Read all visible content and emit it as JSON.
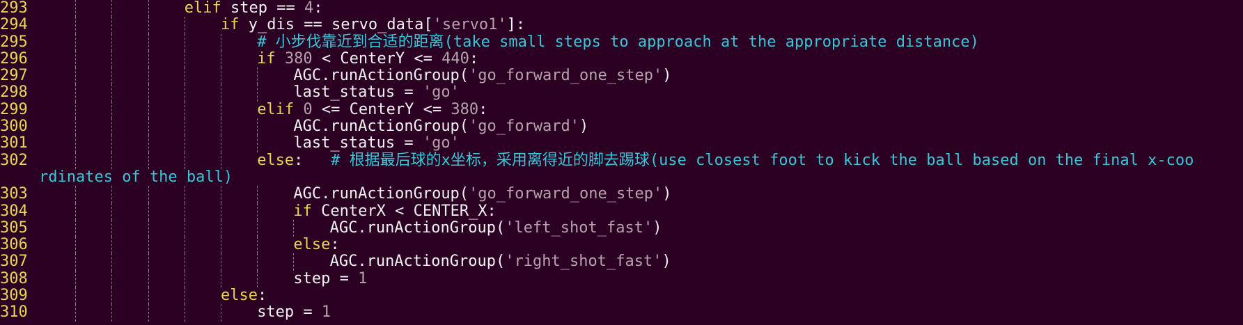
{
  "editor": {
    "lines": [
      {
        "num": "293",
        "indent": 4,
        "tokens": [
          {
            "t": "kw",
            "v": "elif"
          },
          {
            "t": "tx",
            "v": " step == "
          },
          {
            "t": "num",
            "v": "4"
          },
          {
            "t": "tx",
            "v": ":"
          }
        ]
      },
      {
        "num": "294",
        "indent": 5,
        "tokens": [
          {
            "t": "kw",
            "v": "if"
          },
          {
            "t": "tx",
            "v": " y_dis == servo_data["
          },
          {
            "t": "str",
            "v": "'servo1'"
          },
          {
            "t": "tx",
            "v": "]:"
          }
        ]
      },
      {
        "num": "295",
        "indent": 6,
        "tokens": [
          {
            "t": "cm",
            "v": "# 小步伐靠近到合适的距离(take small steps to approach at the appropriate distance)"
          }
        ]
      },
      {
        "num": "296",
        "indent": 6,
        "tokens": [
          {
            "t": "kw",
            "v": "if"
          },
          {
            "t": "tx",
            "v": " "
          },
          {
            "t": "num",
            "v": "380"
          },
          {
            "t": "tx",
            "v": " < CenterY <= "
          },
          {
            "t": "num",
            "v": "440"
          },
          {
            "t": "tx",
            "v": ":"
          }
        ]
      },
      {
        "num": "297",
        "indent": 7,
        "tokens": [
          {
            "t": "tx",
            "v": "AGC.runActionGroup("
          },
          {
            "t": "str",
            "v": "'go_forward_one_step'"
          },
          {
            "t": "tx",
            "v": ")"
          }
        ]
      },
      {
        "num": "298",
        "indent": 7,
        "tokens": [
          {
            "t": "tx",
            "v": "last_status = "
          },
          {
            "t": "str",
            "v": "'go'"
          }
        ]
      },
      {
        "num": "299",
        "indent": 6,
        "tokens": [
          {
            "t": "kw",
            "v": "elif"
          },
          {
            "t": "tx",
            "v": " "
          },
          {
            "t": "num",
            "v": "0"
          },
          {
            "t": "tx",
            "v": " <= CenterY <= "
          },
          {
            "t": "num",
            "v": "380"
          },
          {
            "t": "tx",
            "v": ":"
          }
        ]
      },
      {
        "num": "300",
        "indent": 7,
        "tokens": [
          {
            "t": "tx",
            "v": "AGC.runActionGroup("
          },
          {
            "t": "str",
            "v": "'go_forward'"
          },
          {
            "t": "tx",
            "v": ")"
          }
        ]
      },
      {
        "num": "301",
        "indent": 7,
        "tokens": [
          {
            "t": "tx",
            "v": "last_status = "
          },
          {
            "t": "str",
            "v": "'go'"
          }
        ]
      },
      {
        "num": "302",
        "indent": 6,
        "tokens": [
          {
            "t": "kw",
            "v": "else"
          },
          {
            "t": "tx",
            "v": ":   "
          },
          {
            "t": "cm",
            "v": "# 根据最后球的x坐标，采用离得近的脚去踢球(use closest foot to kick the ball based on the final x-coo"
          }
        ]
      },
      {
        "num": "",
        "indent": 0,
        "wrap": true,
        "tokens": [
          {
            "t": "cm",
            "v": "rdinates of the ball)"
          }
        ]
      },
      {
        "num": "303",
        "indent": 7,
        "tokens": [
          {
            "t": "tx",
            "v": "AGC.runActionGroup("
          },
          {
            "t": "str",
            "v": "'go_forward_one_step'"
          },
          {
            "t": "tx",
            "v": ")"
          }
        ]
      },
      {
        "num": "304",
        "indent": 7,
        "tokens": [
          {
            "t": "kw",
            "v": "if"
          },
          {
            "t": "tx",
            "v": " CenterX < CENTER_X:"
          }
        ]
      },
      {
        "num": "305",
        "indent": 8,
        "tokens": [
          {
            "t": "tx",
            "v": "AGC.runActionGroup("
          },
          {
            "t": "str",
            "v": "'left_shot_fast'"
          },
          {
            "t": "tx",
            "v": ")"
          }
        ]
      },
      {
        "num": "306",
        "indent": 7,
        "tokens": [
          {
            "t": "kw",
            "v": "else"
          },
          {
            "t": "tx",
            "v": ":"
          }
        ]
      },
      {
        "num": "307",
        "indent": 8,
        "tokens": [
          {
            "t": "tx",
            "v": "AGC.runActionGroup("
          },
          {
            "t": "str",
            "v": "'right_shot_fast'"
          },
          {
            "t": "tx",
            "v": ")"
          }
        ]
      },
      {
        "num": "308",
        "indent": 7,
        "tokens": [
          {
            "t": "tx",
            "v": "step = "
          },
          {
            "t": "num",
            "v": "1"
          }
        ]
      },
      {
        "num": "309",
        "indent": 5,
        "tokens": [
          {
            "t": "kw",
            "v": "else"
          },
          {
            "t": "tx",
            "v": ":"
          }
        ]
      },
      {
        "num": "310",
        "indent": 6,
        "tokens": [
          {
            "t": "tx",
            "v": "step = "
          },
          {
            "t": "num",
            "v": "1"
          }
        ]
      }
    ]
  },
  "colors": {
    "background": "#2c0023",
    "keyword": "#e8d84a",
    "line_number": "#e8d84a",
    "string_number": "#b5a2ad",
    "comment": "#33c9d8",
    "text": "#f2f2f2"
  }
}
